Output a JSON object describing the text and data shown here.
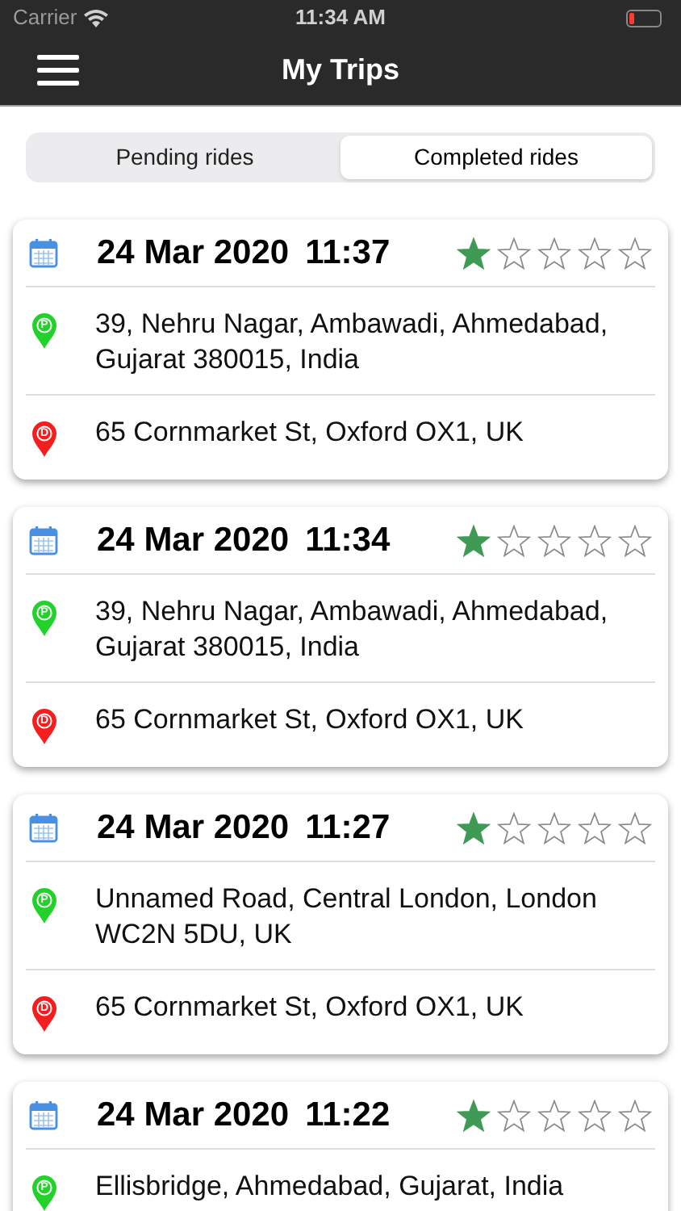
{
  "status_bar": {
    "carrier": "Carrier",
    "time": "11:34 AM"
  },
  "nav": {
    "title": "My Trips"
  },
  "tabs": [
    {
      "label": "Pending rides",
      "selected": false
    },
    {
      "label": "Completed rides",
      "selected": true
    }
  ],
  "trips": [
    {
      "date": "24 Mar 2020",
      "time": "11:37",
      "stars": 1,
      "pickup": {
        "pin_label": "P",
        "address": "39, Nehru Nagar, Ambawadi, Ahmedabad, Gujarat 380015, India"
      },
      "dropoff": {
        "pin_label": "D",
        "address": "65 Cornmarket St, Oxford OX1, UK"
      }
    },
    {
      "date": "24 Mar 2020",
      "time": "11:34",
      "stars": 1,
      "pickup": {
        "pin_label": "P",
        "address": "39, Nehru Nagar, Ambawadi, Ahmedabad, Gujarat 380015, India"
      },
      "dropoff": {
        "pin_label": "D",
        "address": "65 Cornmarket St, Oxford OX1, UK"
      }
    },
    {
      "date": "24 Mar 2020",
      "time": "11:27",
      "stars": 1,
      "pickup": {
        "pin_label": "P",
        "address": "Unnamed Road, Central London, London WC2N 5DU, UK"
      },
      "dropoff": {
        "pin_label": "D",
        "address": "65 Cornmarket St, Oxford OX1, UK"
      }
    },
    {
      "date": "24 Mar 2020",
      "time": "11:22",
      "stars": 1,
      "pickup": {
        "pin_label": "P",
        "address": "Ellisbridge, Ahmedabad, Gujarat, India"
      }
    }
  ]
}
